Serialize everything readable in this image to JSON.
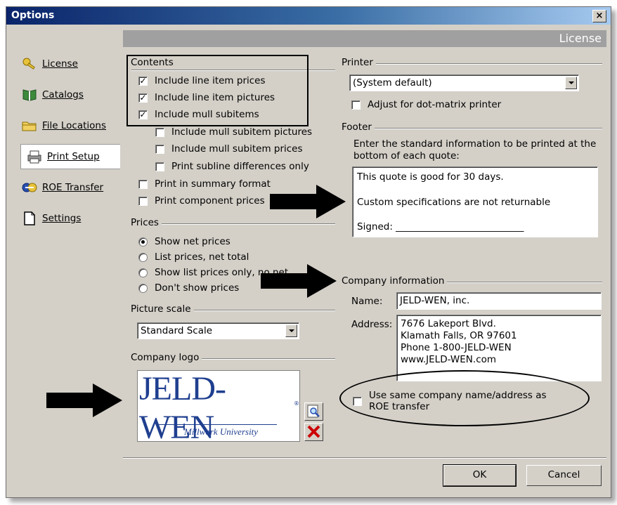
{
  "window": {
    "title": "Options",
    "close_glyph": "×"
  },
  "section_title": "License",
  "nav": [
    {
      "label": "License",
      "icon": "key-icon"
    },
    {
      "label": "Catalogs",
      "icon": "book-icon"
    },
    {
      "label": "File Locations",
      "icon": "folder-icon"
    },
    {
      "label": "Print Setup",
      "icon": "printer-icon",
      "selected": true
    },
    {
      "label": "ROE Transfer",
      "icon": "transfer-icon"
    },
    {
      "label": "Settings",
      "icon": "document-icon"
    }
  ],
  "contents": {
    "label": "Contents",
    "items": [
      {
        "label": "Include line item prices",
        "checked": true
      },
      {
        "label": "Include line item pictures",
        "checked": true
      },
      {
        "label": "Include mull subitems",
        "checked": true
      },
      {
        "label": "Include mull subitem pictures",
        "checked": false
      },
      {
        "label": "Include mull subitem prices",
        "checked": false
      },
      {
        "label": "Print subline differences only",
        "checked": false
      },
      {
        "label": "Print in summary format",
        "checked": false
      },
      {
        "label": "Print component prices",
        "checked": false
      }
    ]
  },
  "prices": {
    "label": "Prices",
    "options": [
      {
        "label": "Show net prices",
        "selected": true
      },
      {
        "label": "List prices, net total",
        "selected": false
      },
      {
        "label": "Show list prices only, no net",
        "selected": false
      },
      {
        "label": "Don't show prices",
        "selected": false
      }
    ]
  },
  "picture_scale": {
    "label": "Picture scale",
    "value": "Standard Scale"
  },
  "company_logo": {
    "label": "Company logo",
    "logo_text": "JELD-WEN",
    "logo_subtext": "Millwork University",
    "registered_mark": "®"
  },
  "printer": {
    "label": "Printer",
    "value": "(System default)",
    "dot_matrix_label": "Adjust for dot-matrix printer",
    "dot_matrix_checked": false
  },
  "footer": {
    "label": "Footer",
    "instructions": "Enter the standard information to be printed at the bottom of each quote:",
    "lines": [
      "This quote is good for 30 days.",
      "Custom specifications are not returnable",
      "Signed: ___________________________"
    ]
  },
  "company_info": {
    "label": "Company information",
    "name_label": "Name:",
    "name_value": "JELD-WEN, inc.",
    "address_label": "Address:",
    "address_lines": [
      "7676 Lakeport Blvd.",
      "Klamath Falls, OR 97601",
      "Phone 1-800-JELD-WEN",
      "www.JELD-WEN.com"
    ],
    "same_as_roe_label": "Use same company name/address as ROE transfer",
    "same_as_roe_checked": false
  },
  "buttons": {
    "ok": "OK",
    "cancel": "Cancel"
  },
  "colors": {
    "dialog_bg": "#d4d0c8",
    "titlebar": "#0a246a",
    "header_bar": "#a0a0a0",
    "delete_red": "#cc0000",
    "logo_blue": "#1f3f8f"
  }
}
